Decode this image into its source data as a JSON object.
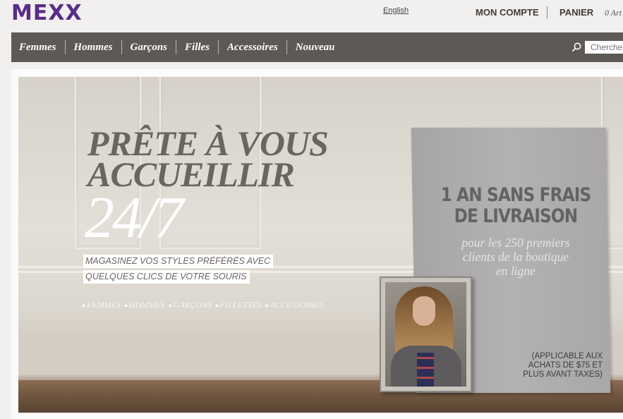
{
  "header": {
    "logo": "MEXX",
    "language_link": "English",
    "account_link": "MON COMPTE",
    "cart_link": "PANIER",
    "cart_count": "0 Art"
  },
  "nav": {
    "items": [
      "Femmes",
      "Hommes",
      "Garçons",
      "Filles",
      "Accessoires",
      "Nouveau"
    ],
    "search_placeholder": "Cherche"
  },
  "banner": {
    "headline_line1": "PRÊTE À VOUS",
    "headline_line2": "ACCUEILLIR",
    "headline_247": "24/7",
    "tagline_line1": "MAGASINEZ VOS STYLES PRÉFÉRÉS AVEC",
    "tagline_line2": "QUELQUES CLICS DE VOTRE SOURIS",
    "links": [
      "FEMMES",
      "HOMMES",
      "GARÇONS",
      "FILLETTES",
      "ACCESSOIRES"
    ],
    "sign_title_line1": "1 AN SANS FRAIS",
    "sign_title_line2": "DE LIVRAISON",
    "sign_sub_line1": "pour les 250 premiers",
    "sign_sub_line2": "clients de la boutique",
    "sign_sub_line3": "en ligne",
    "sign_note_line1": "(APPLICABLE AUX",
    "sign_note_line2": "ACHATS DE $75 ET",
    "sign_note_line3": "PLUS AVANT TAXES)"
  },
  "colors": {
    "brand": "#5a2d87",
    "nav_bg": "#5f5955"
  },
  "icons": {
    "search": "search-icon"
  }
}
